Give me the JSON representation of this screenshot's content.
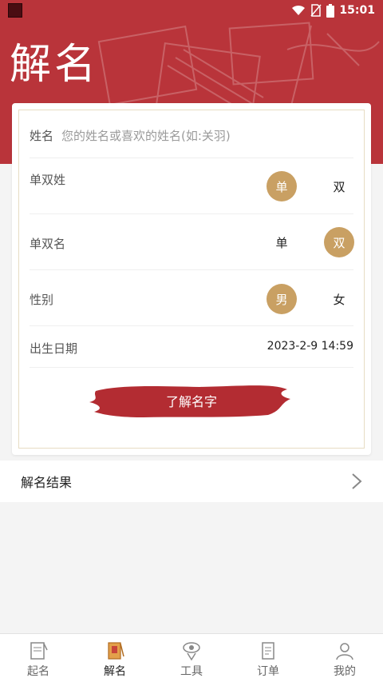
{
  "status_bar": {
    "time": "15:01"
  },
  "header": {
    "title": "解名"
  },
  "form": {
    "name_label": "姓名",
    "name_placeholder": "您的姓名或喜欢的姓名(如:关羽)",
    "surname_type": {
      "label": "单双姓",
      "options": [
        "单",
        "双"
      ],
      "selected": "单"
    },
    "given_type": {
      "label": "单双名",
      "options": [
        "单",
        "双"
      ],
      "selected": "双"
    },
    "gender": {
      "label": "性别",
      "options": [
        "男",
        "女"
      ],
      "selected": "男"
    },
    "birth": {
      "label": "出生日期",
      "value": "2023-2-9 14:59"
    },
    "submit_label": "了解名字"
  },
  "result": {
    "title": "解名结果"
  },
  "nav": {
    "items": [
      {
        "label": "起名",
        "icon": "notebook-icon"
      },
      {
        "label": "解名",
        "icon": "book-icon"
      },
      {
        "label": "工具",
        "icon": "tool-icon"
      },
      {
        "label": "订单",
        "icon": "order-icon"
      },
      {
        "label": "我的",
        "icon": "user-icon"
      }
    ],
    "active": "解名"
  },
  "colors": {
    "brand_red": "#b9343a",
    "accent_gold": "#c9a063"
  }
}
